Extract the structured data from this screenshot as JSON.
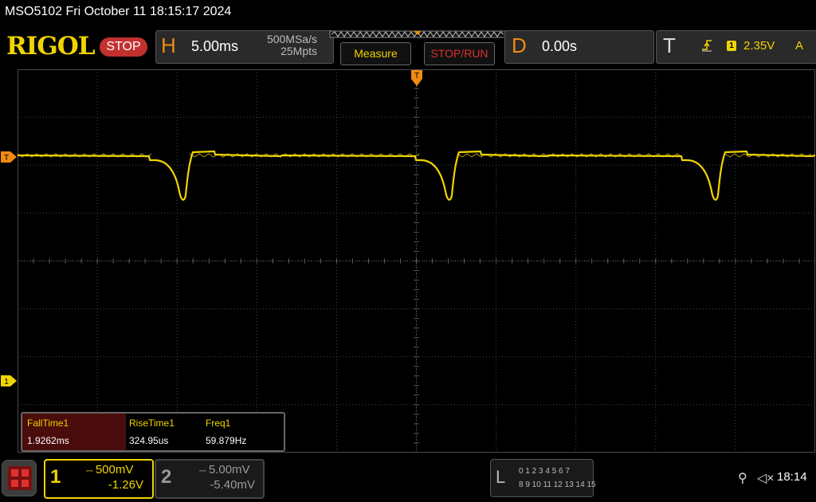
{
  "header": {
    "device_title": "MSO5102  Fri October 11 18:15:17 2024",
    "logo": "RIGOL",
    "status": "STOP"
  },
  "horizontal": {
    "letter": "H",
    "timebase": "5.00ms",
    "sample_rate": "500MSa/s",
    "memory_depth": "25Mpts"
  },
  "buttons": {
    "measure": "Measure",
    "stop_run": "STOP/RUN"
  },
  "delay": {
    "letter": "D",
    "value": "0.00s"
  },
  "trigger": {
    "letter": "T",
    "source": "1",
    "level": "2.35V",
    "mode": "A",
    "edge_icon": "rising-edge-icon"
  },
  "markers": {
    "trigger_top": "T",
    "trigger_left": "T",
    "ch1": "1"
  },
  "measurements": [
    {
      "name": "FallTime1",
      "value": "1.9262ms"
    },
    {
      "name": "RiseTime1",
      "value": "324.95us"
    },
    {
      "name": "Freq1",
      "value": "59.879Hz"
    }
  ],
  "channels": {
    "ch1": {
      "number": "1",
      "scale": "500mV",
      "offset": "-1.26V"
    },
    "ch2": {
      "number": "2",
      "scale": "5.00mV",
      "offset": "-5.40mV"
    }
  },
  "logic_analyzer": {
    "letter": "L",
    "row1": "0 1 2 3  4 5 6 7",
    "row2": "8 9 10 11 12 13 14 15"
  },
  "status_bar": {
    "usb_icon": "usb-icon",
    "speaker_icon": "speaker-muted-icon",
    "clock": "18:14"
  },
  "colors": {
    "ch1": "#f0d400",
    "accent_orange": "#f08a10",
    "stop_red": "#c33030",
    "grid": "#4a4a4a"
  }
}
